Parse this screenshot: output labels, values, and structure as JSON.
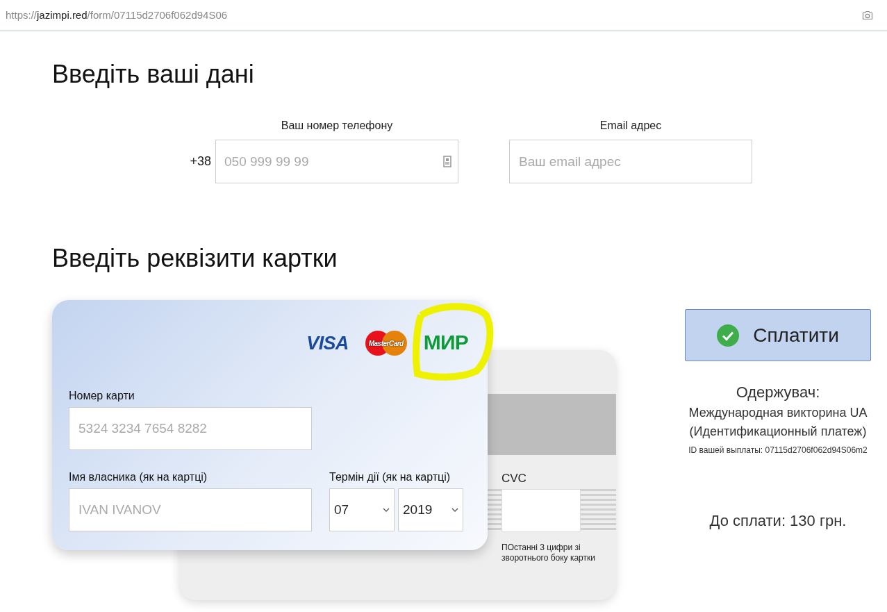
{
  "address_bar": {
    "scheme": "https://",
    "domain": "jazimpi.red",
    "path": "/form/07115d2706f062d94S06"
  },
  "contact": {
    "title": "Введіть ваші дані",
    "phone": {
      "label": "Ваш номер телефону",
      "prefix": "+38",
      "placeholder": "050 999 99 99"
    },
    "email": {
      "label": "Email адрес",
      "placeholder": "Ваш email адрес"
    }
  },
  "card": {
    "title": "Введіть реквізити картки",
    "logos": [
      {
        "kind": "visa",
        "text": "VISA"
      },
      {
        "kind": "mastercard",
        "text": "MasterCard"
      },
      {
        "kind": "mir",
        "text": "МИР"
      }
    ],
    "number": {
      "label": "Номер карти",
      "placeholder": "5324 3234 7654 8282"
    },
    "holder": {
      "label": "Імя власника (як на картці)",
      "placeholder": "IVAN IVANOV"
    },
    "expiry": {
      "label": "Термін дії (як на картці)",
      "month": "07",
      "year": "2019"
    },
    "cvc": {
      "label": "CVC",
      "hint": "ПОстанні 3 цифри зі зворотнього боку картки"
    }
  },
  "payment": {
    "button": "Сплатити",
    "recipient_label": "Одержувач:",
    "recipient_lines": [
      "Международная викторина UA",
      "(Идентификационный платеж)"
    ],
    "payout_id": "ID вашей выплаты: 07115d2706f062d94S06m2",
    "amount": "До сплати: 130 грн."
  }
}
